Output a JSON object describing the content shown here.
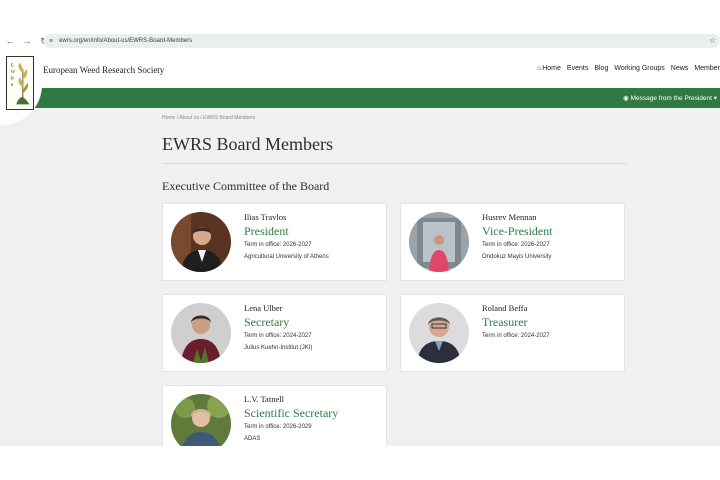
{
  "browser": {
    "url": "ewrs.org/en/info/About-us/EWRS-Board-Members",
    "back_icon": "arrow-left-icon",
    "forward_icon": "arrow-right-icon",
    "reload_icon": "reload-icon",
    "star_icon": "star-icon"
  },
  "site": {
    "title": "European Weed Research Society",
    "logo_text": "EWRS",
    "nav": [
      {
        "label": "Home",
        "icon": "home-icon"
      },
      {
        "label": "Events"
      },
      {
        "label": "Blog"
      },
      {
        "label": "Working Groups"
      },
      {
        "label": "News"
      },
      {
        "label": "Member"
      }
    ],
    "president_message": "Message from the President",
    "green_color": "#2f7a43"
  },
  "breadcrumb": [
    "Home",
    "About us",
    "EWRS Board Members"
  ],
  "page_title": "EWRS Board Members",
  "section_title": "Executive Committee of the Board",
  "members": [
    {
      "name": "Ilias Travlos",
      "role": "President",
      "term": "Term in office: 2026-2027",
      "org": "Agricultural University of Athens"
    },
    {
      "name": "Husrev Mennan",
      "role": "Vice-President",
      "term": "Term in office: 2026-2027",
      "org": "Ondokuz Mayis University"
    },
    {
      "name": "Lena Ulber",
      "role": "Secretary",
      "term": "Term in office: 2024-2027",
      "org": "Julius Kuehn-Institut (JKI)"
    },
    {
      "name": "Roland Beffa",
      "role": "Treasurer",
      "term": "Term in office: 2024-2027",
      "org": ""
    },
    {
      "name": "L.V. Tatnell",
      "role": "Scientific Secretary",
      "term": "Term in office: 2026-2029",
      "org": "ADAS"
    }
  ]
}
